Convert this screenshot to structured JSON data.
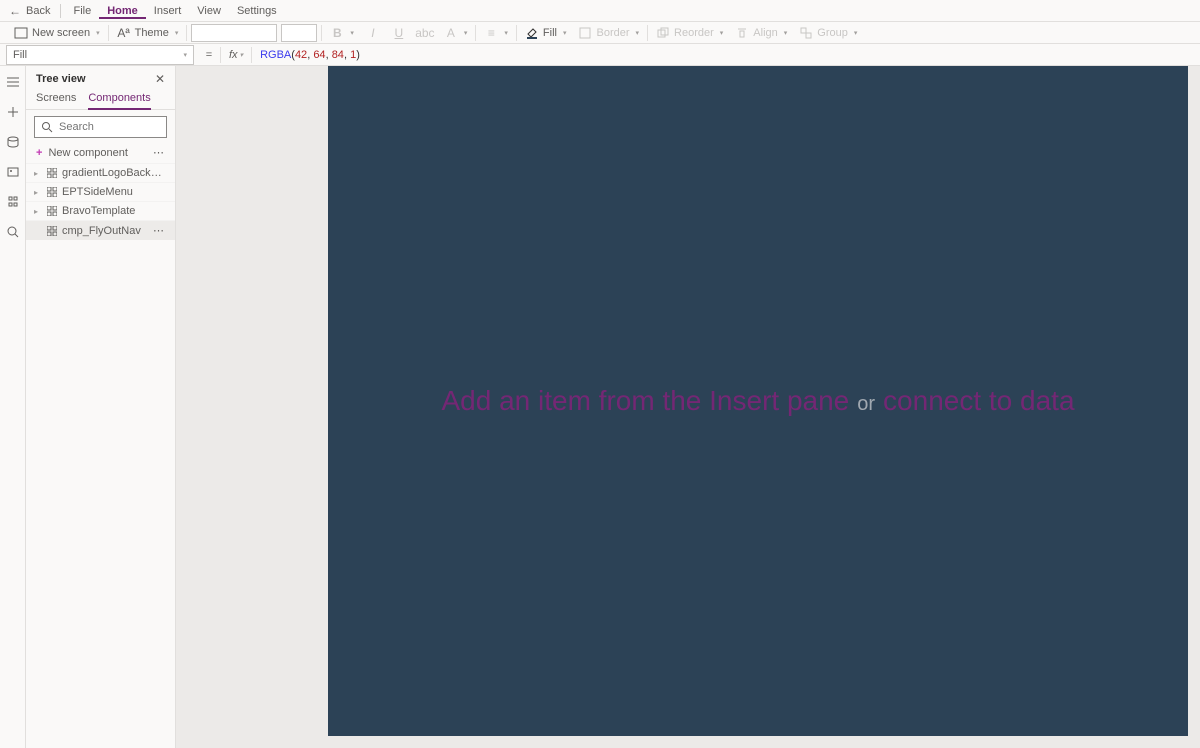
{
  "topmenu": {
    "back": "Back",
    "items": [
      "File",
      "Home",
      "Insert",
      "View",
      "Settings"
    ],
    "active": "Home"
  },
  "ribbon": {
    "new_screen": "New screen",
    "theme": "Theme",
    "fill": "Fill",
    "border": "Border",
    "reorder": "Reorder",
    "align": "Align",
    "group": "Group"
  },
  "formula": {
    "property": "Fill",
    "fx": "fx",
    "fn": "RGBA",
    "args": [
      "42",
      "64",
      "84",
      "1"
    ]
  },
  "tree": {
    "title": "Tree view",
    "tabs": {
      "screens": "Screens",
      "components": "Components"
    },
    "search_placeholder": "Search",
    "new_component": "New component",
    "items": [
      {
        "label": "gradientLogoBackground",
        "selected": false
      },
      {
        "label": "EPTSideMenu",
        "selected": false
      },
      {
        "label": "BravoTemplate",
        "selected": false
      },
      {
        "label": "cmp_FlyOutNav",
        "selected": true
      }
    ]
  },
  "canvas": {
    "hint_insert": "Add an item from the Insert pane",
    "hint_or": "or",
    "hint_connect": "connect to data"
  }
}
